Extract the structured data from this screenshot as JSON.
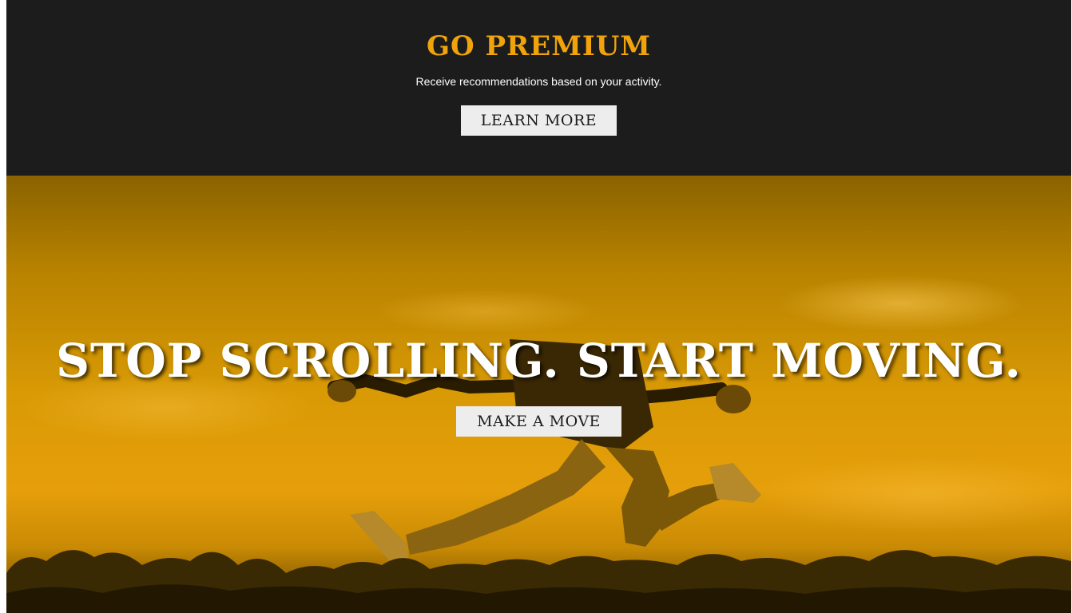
{
  "premium": {
    "title": "GO PREMIUM",
    "subtitle": "Receive recommendations based on your activity.",
    "button_label": "LEARN MORE"
  },
  "hero": {
    "headline": "STOP SCROLLING. START MOVING.",
    "button_label": "MAKE A MOVE"
  },
  "colors": {
    "accent": "#f0a30a",
    "banner_bg": "#1c1c1c",
    "button_bg": "#ededed"
  }
}
